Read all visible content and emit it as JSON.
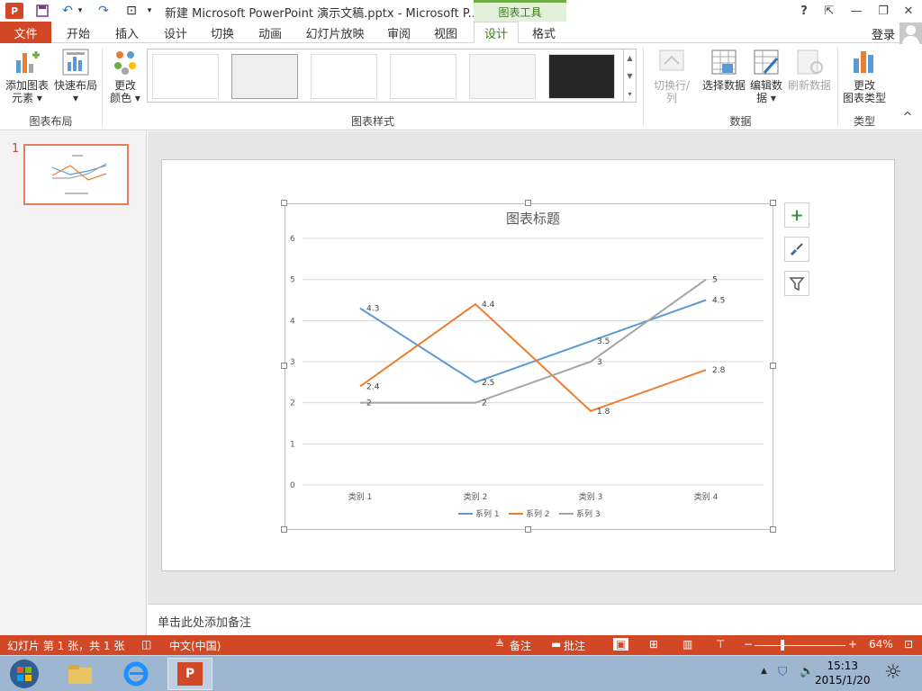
{
  "window": {
    "title": "新建 Microsoft PowerPoint 演示文稿.pptx - Microsoft P...",
    "contextual_tab_group": "图表工具",
    "help": "?",
    "login": "登录",
    "min": "—",
    "restore": "❐",
    "close": "✕",
    "ribbon_opts": "⇱"
  },
  "quick_access": {
    "save": "💾",
    "undo": "↶",
    "redo": "↷",
    "present": "⊡",
    "customize": "▾"
  },
  "tabs": {
    "file": "文件",
    "items": [
      "开始",
      "插入",
      "设计",
      "切换",
      "动画",
      "幻灯片放映",
      "审阅",
      "视图",
      "设计",
      "格式"
    ],
    "active_index": 8
  },
  "ribbon": {
    "add_chart_element": [
      "添加图表",
      "元素 ▾"
    ],
    "quick_layout": [
      "快速布局",
      "▾"
    ],
    "change_colors": [
      "更改",
      "颜色 ▾"
    ],
    "group_layout": "图表布局",
    "group_styles": "图表样式",
    "switch_row_col": "切换行/列",
    "select_data": "选择数据",
    "edit_data": [
      "编辑数",
      "据 ▾"
    ],
    "refresh_data": "刷新数据",
    "group_data": "数据",
    "change_chart_type": [
      "更改",
      "图表类型"
    ],
    "group_type": "类型",
    "collapse": "^"
  },
  "slides_pane": {
    "number": "1"
  },
  "notes": {
    "placeholder": "单击此处添加备注"
  },
  "chart_data": {
    "type": "line",
    "title": "图表标题",
    "categories": [
      "类别 1",
      "类别 2",
      "类别 3",
      "类别 4"
    ],
    "series": [
      {
        "name": "系列 1",
        "values": [
          4.3,
          2.5,
          3.5,
          4.5
        ],
        "color": "#5b9bd5"
      },
      {
        "name": "系列 2",
        "values": [
          2.4,
          4.4,
          1.8,
          2.8
        ],
        "color": "#ed7d31"
      },
      {
        "name": "系列 3",
        "values": [
          2,
          2,
          3,
          5
        ],
        "color": "#a5a5a5"
      }
    ],
    "ylim": [
      0,
      6
    ],
    "yticks": [
      0,
      1,
      2,
      3,
      4,
      5,
      6
    ],
    "grid": true,
    "legend_position": "bottom",
    "data_labels": true
  },
  "chart_side_buttons": {
    "elements": "+",
    "styles": "🖌",
    "filter": "▼"
  },
  "statusbar": {
    "slide_info": "幻灯片 第 1 张，共 1 张",
    "language": "中文(中国)",
    "notes": "备注",
    "comments": "批注",
    "zoom": "64%",
    "zoom_minus": "−",
    "zoom_plus": "+"
  },
  "taskbar": {
    "time": "15:13",
    "date": "2015/1/20"
  }
}
